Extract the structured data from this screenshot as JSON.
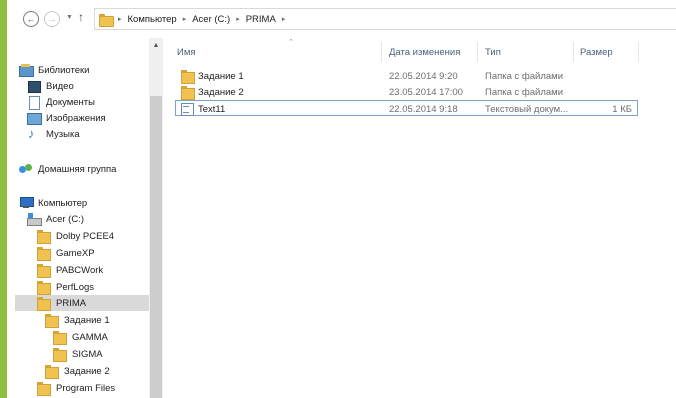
{
  "address": {
    "back_icon": "arrow-left",
    "forward_icon": "arrow-right",
    "recent_icon": "chevron-down",
    "up_icon": "arrow-up",
    "crumbs": [
      "Компьютер",
      "Acer (C:)",
      "PRIMA"
    ],
    "separator": "▸"
  },
  "nav": {
    "libraries": "Библиотеки",
    "video": "Видео",
    "documents": "Документы",
    "images": "Изображения",
    "music": "Музыка",
    "homegroup": "Домашняя группа",
    "computer": "Компьютер",
    "drive_c": "Acer (C:)",
    "folders": [
      "Dolby PCEE4",
      "GameXP",
      "PABCWork",
      "PerfLogs",
      "PRIMA"
    ],
    "prima_children": [
      "Задание 1"
    ],
    "zad1_children": [
      "GAMMA",
      "SIGMA"
    ],
    "zad2": "Задание 2",
    "program_files": "Program Files",
    "selected": "PRIMA"
  },
  "columns": {
    "name": "Имя",
    "date": "Дата изменения",
    "type": "Тип",
    "size": "Размер"
  },
  "files": [
    {
      "name": "Задание 1",
      "date": "22.05.2014 9:20",
      "type": "Папка с файлами",
      "size": "",
      "icon": "folder-icon"
    },
    {
      "name": "Задание 2",
      "date": "23.05.2014 17:00",
      "type": "Папка с файлами",
      "size": "",
      "icon": "folder-icon"
    },
    {
      "name": "Text11",
      "date": "22.05.2014 9:18",
      "type": "Текстовый докум...",
      "size": "1 КБ",
      "icon": "text-file-icon"
    }
  ],
  "colors": {
    "accent_edge": "#8cbf3f",
    "selection_border": "#7da2ce",
    "nav_selected": "#d9d9d9",
    "header_text": "#4c607a"
  }
}
